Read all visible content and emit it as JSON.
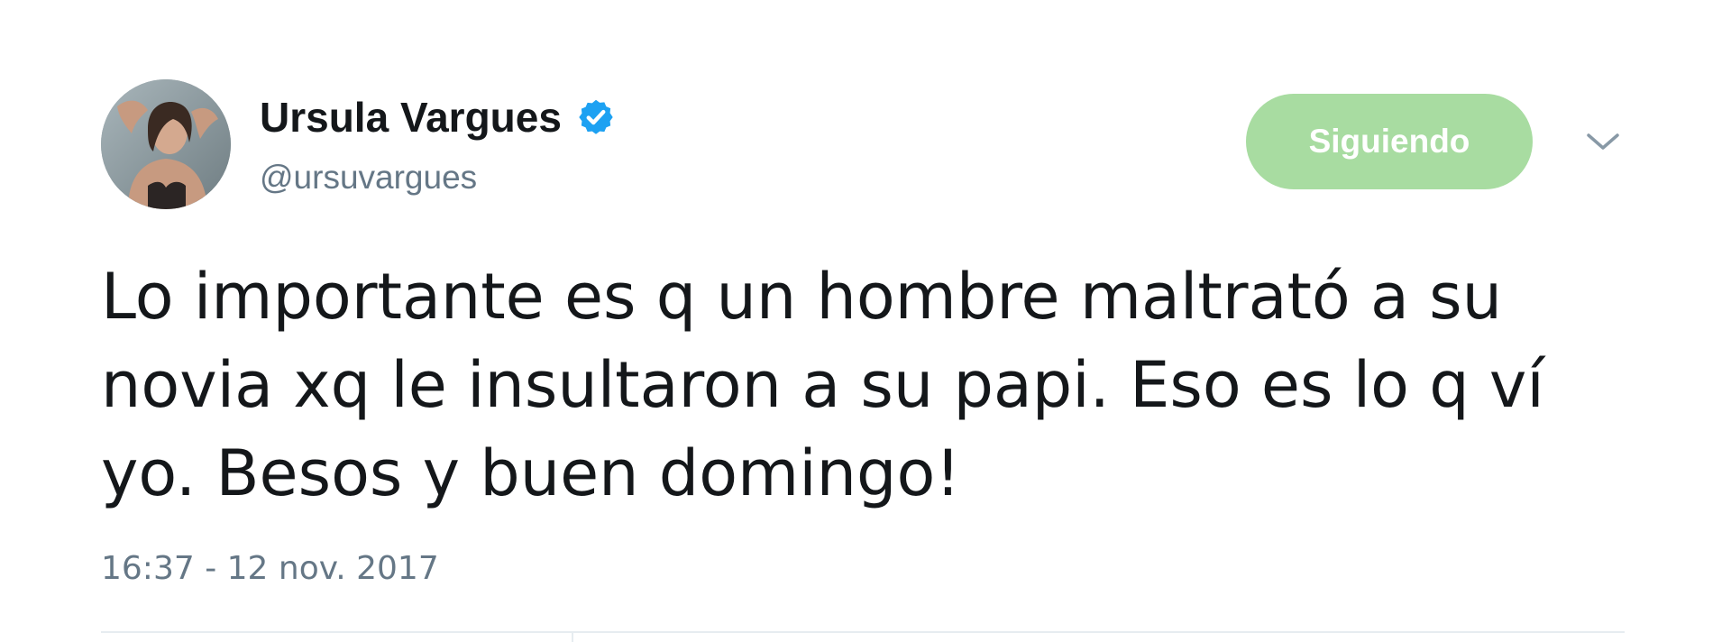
{
  "tweet": {
    "author": {
      "display_name": "Ursula Vargues",
      "handle": "@ursuvargues",
      "verified": true,
      "avatar_icon": "profile-photo",
      "verified_icon": "verified-badge-icon"
    },
    "follow_button_label": "Siguiendo",
    "menu_icon": "chevron-down-icon",
    "text": "Lo importante es q un hombre maltrató a su\nnovia xq le insultaron a su papi. Eso es lo q ví\nyo. Besos y buen domingo!",
    "timestamp": "16:37 - 12 nov. 2017"
  },
  "colors": {
    "verified_blue": "#1da1f2",
    "follow_button_bg": "#a8dca1",
    "muted_text": "#657786",
    "main_text": "#14171a"
  }
}
